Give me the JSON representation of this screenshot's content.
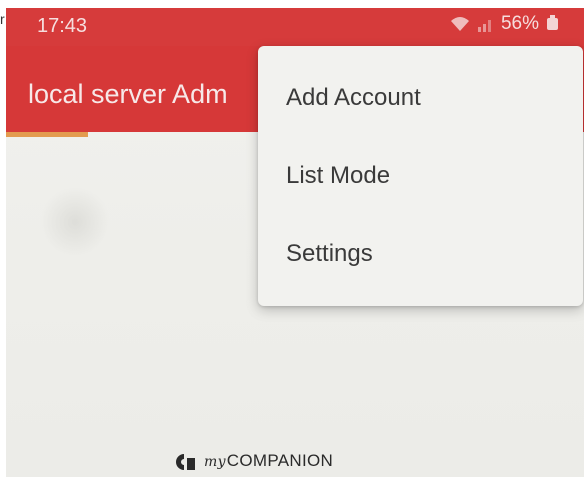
{
  "status_bar": {
    "time": "17:43",
    "battery_percent": "56%",
    "icons": [
      "wifi-icon",
      "signal-icon",
      "battery-icon"
    ]
  },
  "app_bar": {
    "title": "local server Adm"
  },
  "overflow_menu": {
    "items": [
      {
        "label": "Add Account"
      },
      {
        "label": "List Mode"
      },
      {
        "label": "Settings"
      }
    ]
  },
  "footer": {
    "brand_prefix": "my",
    "brand_name": "COMPANION",
    "icon": "companion-logo"
  },
  "colors": {
    "app_bar": "#d63838",
    "tab_indicator": "#e39b4f",
    "menu_background": "#f2f2ef",
    "menu_text": "#3a3a3a"
  }
}
